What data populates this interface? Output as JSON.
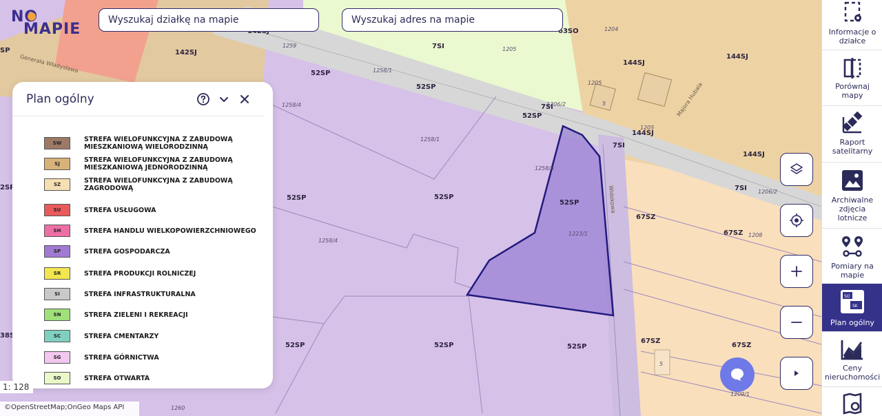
{
  "logo": {
    "line1": "NO",
    "line2": "MAPIE"
  },
  "search_parcel": {
    "placeholder": "Wyszukaj działkę na mapie"
  },
  "search_address": {
    "placeholder": "Wyszukaj adres na mapie"
  },
  "legend": {
    "title": "Plan ogólny",
    "items": [
      {
        "code": "SW",
        "label": "STREFA WIELOFUNKCYJNA Z ZABUDOWĄ MIESZKANIOWĄ WIELORODZINNĄ",
        "color": "#9c7a66"
      },
      {
        "code": "SJ",
        "label": "STREFA WIELOFUNKCYJNA Z ZABUDOWĄ MIESZKANIOWĄ JEDNORODZINNĄ",
        "color": "#d7b27a"
      },
      {
        "code": "SZ",
        "label": "STREFA WIELOFUNKCYJNA Z ZABUDOWĄ ZAGRODOWĄ",
        "color": "#f6dfb2"
      },
      {
        "code": "SU",
        "label": "STREFA USŁUGOWA",
        "color": "#ea5a5a"
      },
      {
        "code": "SH",
        "label": "STREFA HANDLU WIELKOPOWIERZCHNIOWEGO",
        "color": "#ee6fa5"
      },
      {
        "code": "SP",
        "label": "STREFA GOSPODARCZA",
        "color": "#a07ad2"
      },
      {
        "code": "SR",
        "label": "STREFA PRODUKCJI ROLNICZEJ",
        "color": "#f3e64f"
      },
      {
        "code": "SI",
        "label": "STREFA INFRASTRUKTURALNA",
        "color": "#c9c9c9"
      },
      {
        "code": "SN",
        "label": "STREFA ZIELENI I REKREACJI",
        "color": "#9fe07a"
      },
      {
        "code": "SC",
        "label": "STREFA CMENTARZY",
        "color": "#7fd0c1"
      },
      {
        "code": "SG",
        "label": "STREFA GÓRNICTWA",
        "color": "#f3c7f0"
      },
      {
        "code": "SO",
        "label": "STREFA OTWARTA",
        "color": "#eaf9c9"
      }
    ]
  },
  "map": {
    "zones": [
      "52SP",
      "52SP",
      "52SP",
      "52SP",
      "52SP",
      "52SP",
      "52SP",
      "52SP",
      "52SP",
      "52SP",
      "7SI",
      "7SI",
      "7SI",
      "7SI",
      "142SJ",
      "142SJ",
      "144SJ",
      "144SJ",
      "144SJ",
      "144SJ",
      "67SZ",
      "67SZ",
      "67SZ",
      "67SZ",
      "67SZ",
      "63SO",
      "38S",
      "2SP",
      "SP"
    ],
    "parcels": [
      "1259",
      "1258/1",
      "1258/4",
      "1258/1",
      "1258/4",
      "1258/4",
      "1223/1",
      "1205",
      "1204",
      "1205",
      "1205",
      "1206/2",
      "1206/2",
      "1208",
      "1209/1",
      "1260",
      "5",
      "5"
    ],
    "streets": [
      "Generała Władysława",
      "Majora Hubala",
      "Widokowa"
    ],
    "scale": "1: 128"
  },
  "attribution": "©OpenStreetMap;OnGeo Maps API",
  "sidebar": [
    {
      "label": "Informacje o działce",
      "icon": "parcel-info-icon"
    },
    {
      "label": "Porównaj mapy",
      "icon": "compare-maps-icon"
    },
    {
      "label": "Raport satelitarny",
      "icon": "satellite-icon"
    },
    {
      "label": "Archiwalne zdjęcia lotnicze",
      "icon": "aerial-photo-icon"
    },
    {
      "label": "Pomiary na mapie",
      "icon": "measure-icon"
    },
    {
      "label": "Plan ogólny",
      "icon": "general-plan-icon"
    },
    {
      "label": "Ceny nieruchomości",
      "icon": "price-chart-icon"
    },
    {
      "label": "",
      "icon": "map-search-icon"
    }
  ],
  "colors": {
    "accent": "#35328a",
    "selected_fill": "#9a82d6"
  }
}
